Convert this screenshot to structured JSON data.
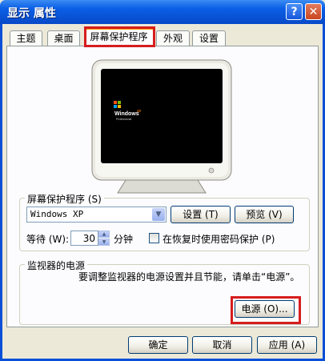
{
  "window": {
    "title": "显示 属性",
    "help_glyph": "?",
    "close_glyph": "✕"
  },
  "tabs": [
    {
      "label": "主题",
      "active": false
    },
    {
      "label": "桌面",
      "active": false
    },
    {
      "label": "屏幕保护程序",
      "active": true
    },
    {
      "label": "外观",
      "active": false
    },
    {
      "label": "设置",
      "active": false
    }
  ],
  "preview": {
    "logo_text": "Windows",
    "logo_suffix": "xp",
    "logo_sub": "Professional"
  },
  "screensaver": {
    "group_label": "屏幕保护程序 (S)",
    "selected": "Windows XP",
    "settings_button": "设置 (T)",
    "preview_button": "预览 (V)",
    "wait_label": "等待 (W):",
    "wait_value": "30",
    "wait_unit": "分钟",
    "password_checkbox_label": "在恢复时使用密码保护 (P)",
    "password_checked": false
  },
  "power": {
    "group_label": "监视器的电源",
    "description": "要调整监视器的电源设置并且节能，请单击“电源”。",
    "power_button": "电源 (O)..."
  },
  "footer": {
    "ok_button": "确定",
    "cancel_button": "取消",
    "apply_button": "应用 (A)"
  },
  "colors": {
    "highlight": "#d61d1d",
    "titlebar": "#0a5fe6",
    "dialog_bg": "#ece9d8"
  }
}
